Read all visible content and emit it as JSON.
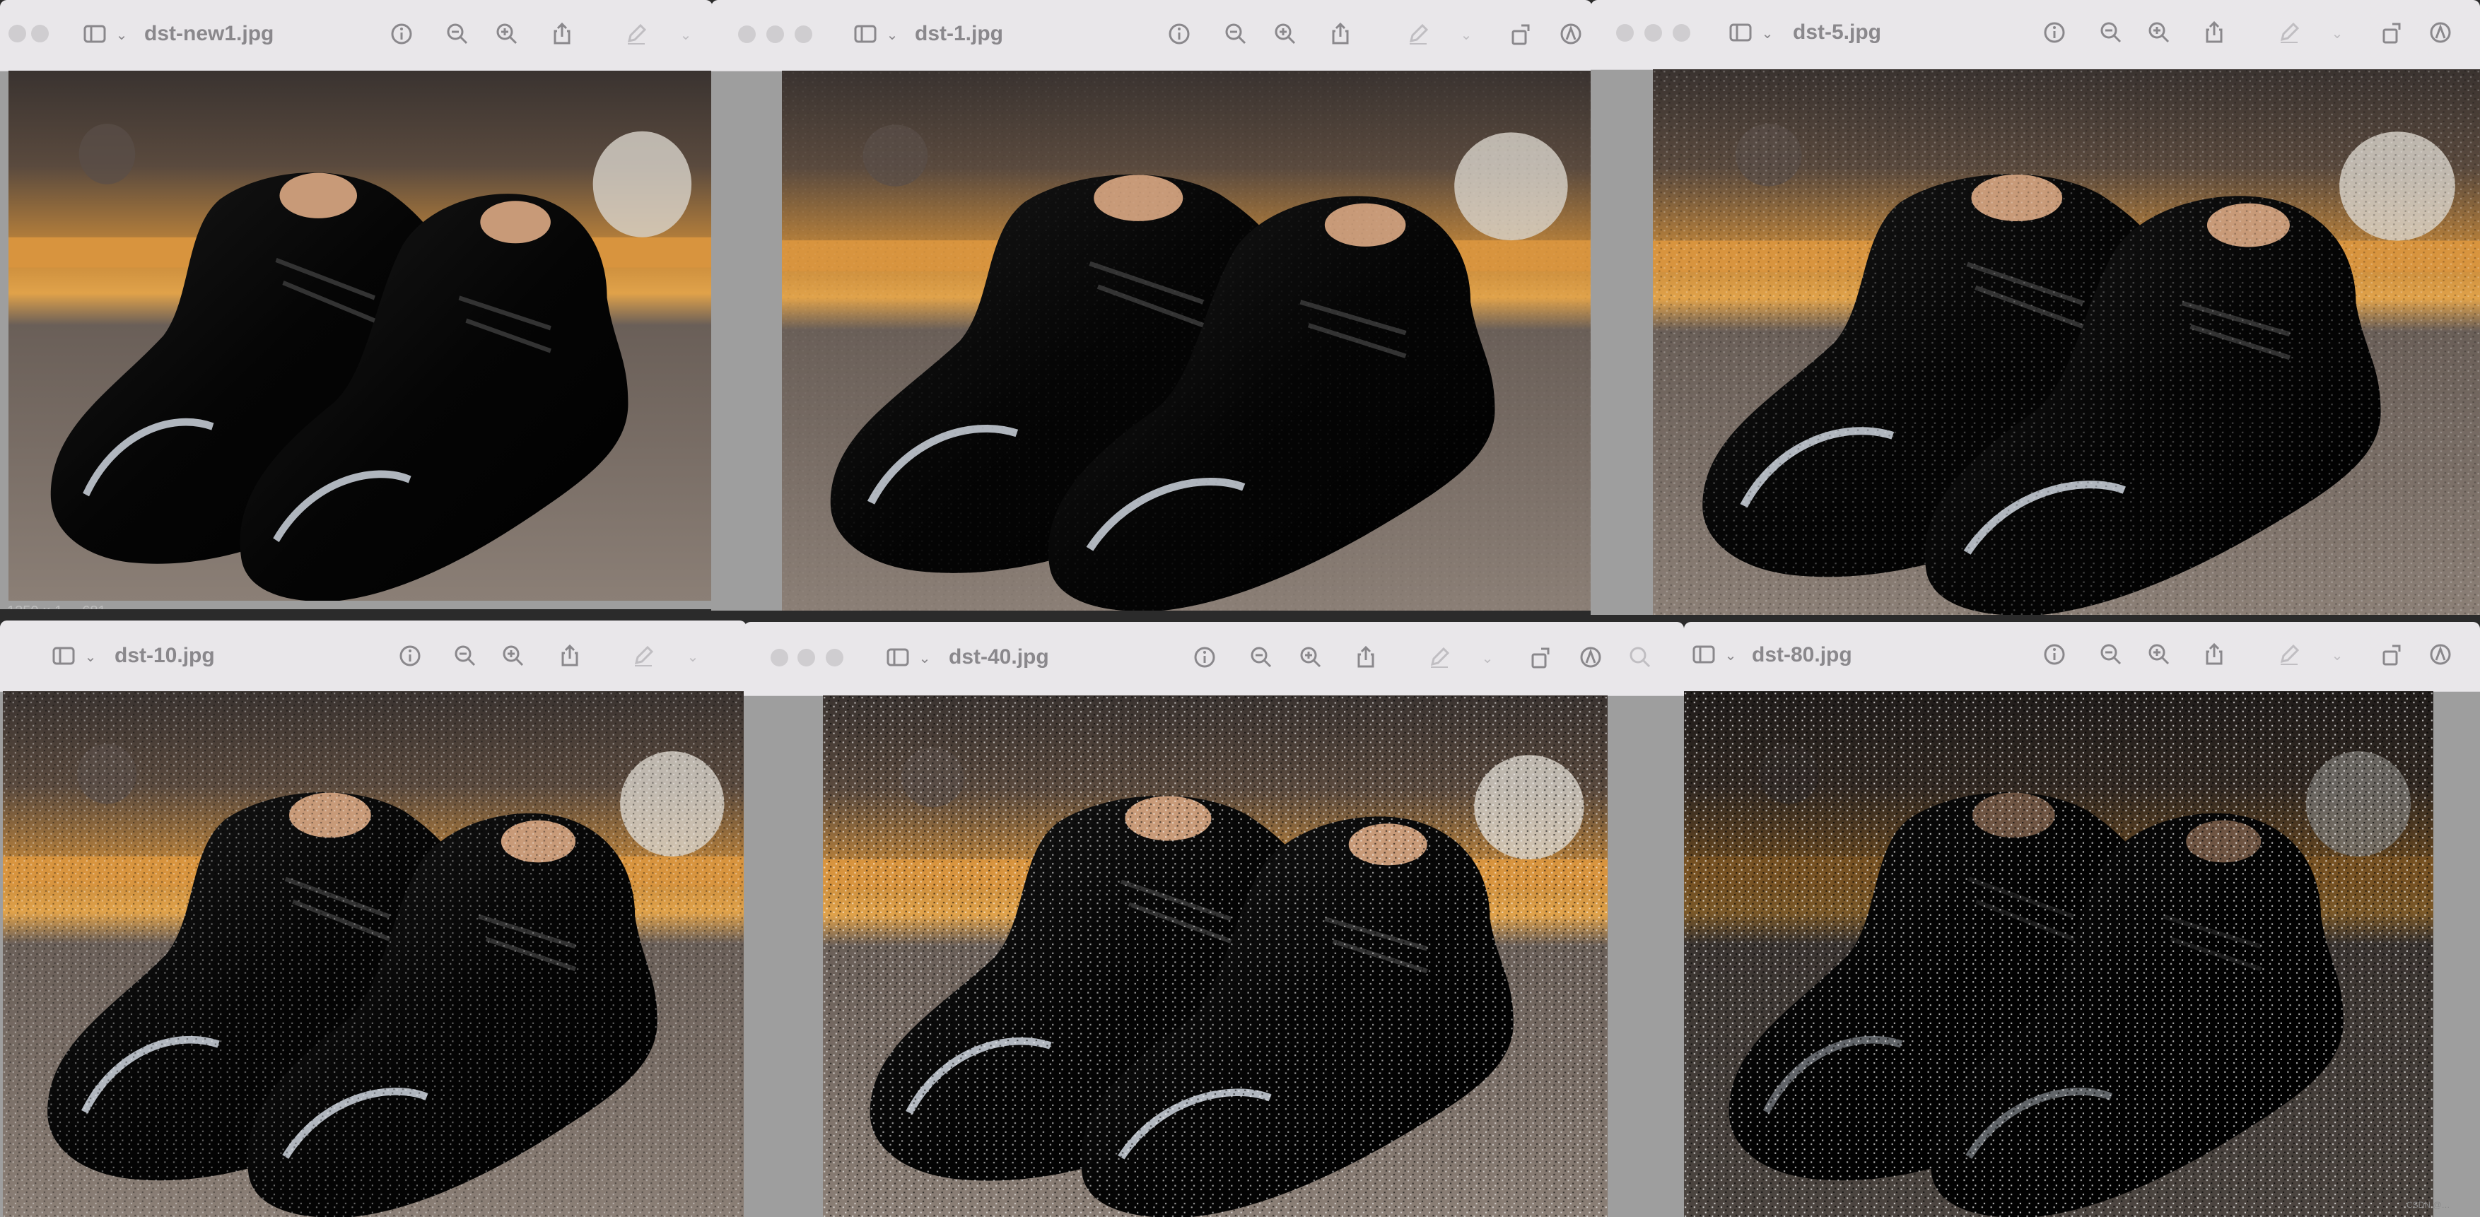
{
  "windows": [
    {
      "title": "dst-new1.jpg",
      "status": "1350 × 1 ... 681"
    },
    {
      "title": "dst-1.jpg"
    },
    {
      "title": "dst-5.jpg"
    },
    {
      "title": "dst-10.jpg"
    },
    {
      "title": "dst-40.jpg"
    },
    {
      "title": "dst-80.jpg"
    }
  ],
  "corner_mark": "CSDN @…",
  "colors": {
    "toolbar": "#e9e7ea",
    "title_text": "#8a888c",
    "window_bg": "#9e9e9e"
  }
}
